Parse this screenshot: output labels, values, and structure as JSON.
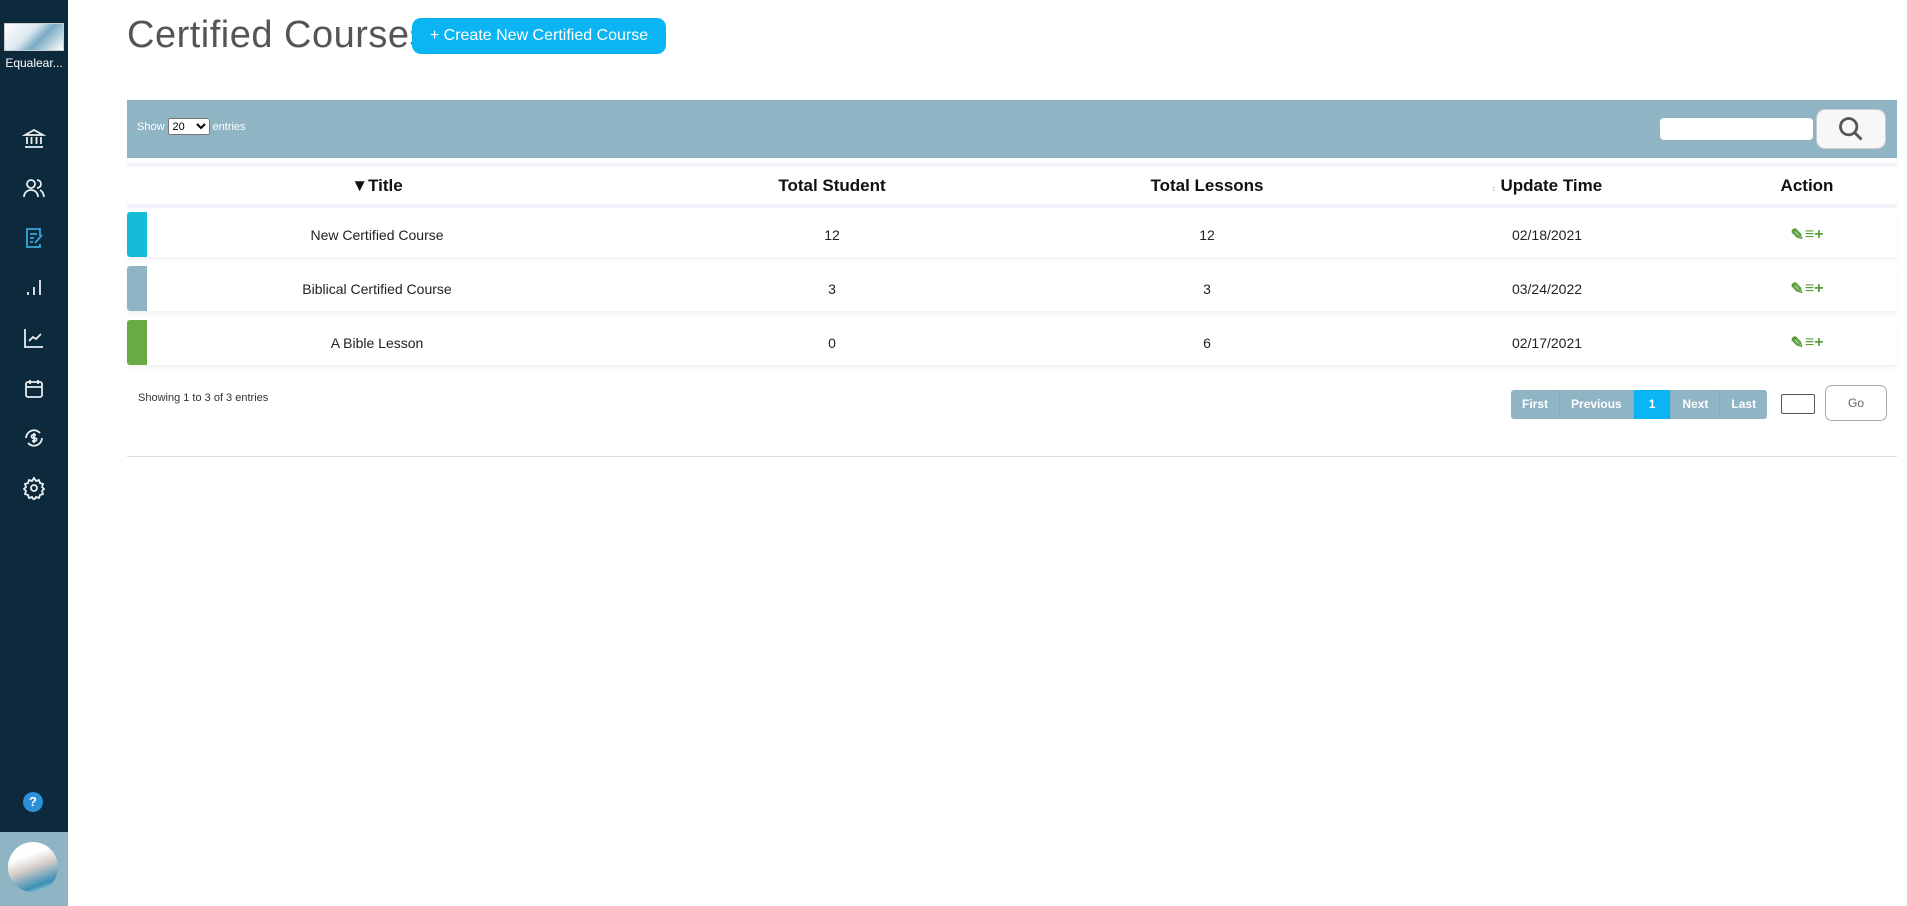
{
  "sidebar": {
    "brand": "Equalear...",
    "items": [
      {
        "name": "institution",
        "icon": "bank-icon"
      },
      {
        "name": "users",
        "icon": "users-icon"
      },
      {
        "name": "courses",
        "icon": "edit-document-icon",
        "active": true
      },
      {
        "name": "reports",
        "icon": "bar-chart-icon"
      },
      {
        "name": "analytics",
        "icon": "line-chart-icon"
      },
      {
        "name": "calendar",
        "icon": "calendar-icon"
      },
      {
        "name": "billing",
        "icon": "dollar-refresh-icon"
      },
      {
        "name": "settings",
        "icon": "gear-icon"
      }
    ],
    "help": "?"
  },
  "page": {
    "title": "Certified Courses",
    "create_label": "+ Create New Certified Course"
  },
  "toolbar": {
    "show_label": "Show",
    "page_size": "20",
    "entries_label": "entries",
    "search_placeholder": ""
  },
  "table": {
    "columns": [
      "▼Title",
      "Total Student",
      "Total Lessons",
      "Update Time",
      "Action"
    ],
    "rows": [
      {
        "title": "New Certified Course",
        "students": "12",
        "lessons": "12",
        "updated": "02/18/2021",
        "color": "#14bcd8"
      },
      {
        "title": "Biblical Certified Course",
        "students": "3",
        "lessons": "3",
        "updated": "03/24/2022",
        "color": "#8fb4c3"
      },
      {
        "title": "A Bible Lesson",
        "students": "0",
        "lessons": "6",
        "updated": "02/17/2021",
        "color": "#6aaa45"
      }
    ]
  },
  "footer": {
    "showing": "Showing 1 to 3 of 3 entries",
    "first": "First",
    "previous": "Previous",
    "current": "1",
    "next": "Next",
    "last": "Last",
    "go": "Go"
  },
  "colors": {
    "sidebar": "#0c2a3b",
    "accent": "#0bb5f4",
    "toolbar": "#8fb4c3",
    "action": "#5a9e3a"
  }
}
